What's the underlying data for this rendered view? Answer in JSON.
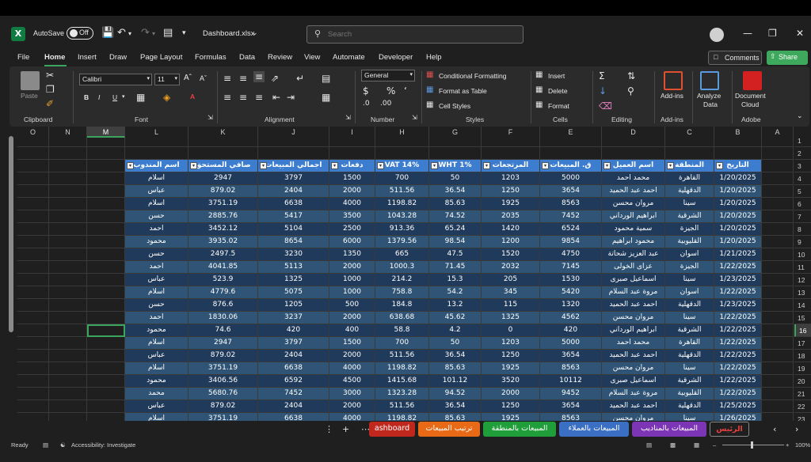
{
  "app": {
    "autosave_label": "AutoSave",
    "autosave_state": "Off",
    "filename": "Dashboard.xlsx",
    "search_placeholder": "Search"
  },
  "menu": [
    "File",
    "Home",
    "Insert",
    "Draw",
    "Page Layout",
    "Formulas",
    "Data",
    "Review",
    "View",
    "Automate",
    "Developer",
    "Help"
  ],
  "menu_active": "Home",
  "comments_label": "Comments",
  "share_label": "Share",
  "ribbon": {
    "clipboard": {
      "label": "Clipboard",
      "paste": "Paste"
    },
    "font": {
      "label": "Font",
      "name": "Calibri",
      "size": "11"
    },
    "alignment": {
      "label": "Alignment"
    },
    "number": {
      "label": "Number",
      "format": "General"
    },
    "styles": {
      "label": "Styles",
      "conditional": "Conditional Formatting",
      "table": "Format as Table",
      "cell": "Cell Styles"
    },
    "cells": {
      "label": "Cells",
      "insert": "Insert",
      "delete": "Delete",
      "format": "Format"
    },
    "editing": {
      "label": "Editing"
    },
    "addins": {
      "label": "Add-ins",
      "btn": "Add-ins"
    },
    "analyze": {
      "btn1": "Analyze",
      "btn2": "Data"
    },
    "adobe": {
      "label": "Adobe",
      "btn1": "Document",
      "btn2": "Cloud"
    }
  },
  "columns": [
    "O",
    "N",
    "M",
    "L",
    "K",
    "J",
    "I",
    "H",
    "G",
    "F",
    "E",
    "D",
    "C",
    "B",
    "A"
  ],
  "selected_column": "M",
  "row_numbers": [
    "1",
    "2",
    "3",
    "4",
    "5",
    "6",
    "7",
    "8",
    "9",
    "10",
    "11",
    "12",
    "13",
    "14",
    "15",
    "16",
    "17",
    "18",
    "19",
    "20",
    "21",
    "22",
    "23"
  ],
  "selected_row": "16",
  "table": {
    "headers": [
      "اسم المندوب",
      "صافي المستحق",
      "اجمالي المبيعات",
      "دفعات",
      "VAT 14%",
      "WHT 1%",
      "المرتجعات",
      "ق. المبيعات",
      "اسم العميل",
      "المنطقة",
      "التاريخ"
    ],
    "rows": [
      [
        "اسلام",
        "2947",
        "3797",
        "1500",
        "700",
        "50",
        "1203",
        "5000",
        "محمد احمد",
        "القاهرة",
        "1/20/2025"
      ],
      [
        "عباس",
        "879.02",
        "2404",
        "2000",
        "511.56",
        "36.54",
        "1250",
        "3654",
        "احمد عبد الحميد",
        "الدقهلية",
        "1/20/2025"
      ],
      [
        "اسلام",
        "3751.19",
        "6638",
        "4000",
        "1198.82",
        "85.63",
        "1925",
        "8563",
        "مروان محسن",
        "سينا",
        "1/20/2025"
      ],
      [
        "حسن",
        "2885.76",
        "5417",
        "3500",
        "1043.28",
        "74.52",
        "2035",
        "7452",
        "ابراهيم الورداني",
        "الشرقية",
        "1/20/2025"
      ],
      [
        "احمد",
        "3452.12",
        "5104",
        "2500",
        "913.36",
        "65.24",
        "1420",
        "6524",
        "سمية محمود",
        "الجيزة",
        "1/20/2025"
      ],
      [
        "محمود",
        "3935.02",
        "8654",
        "6000",
        "1379.56",
        "98.54",
        "1200",
        "9854",
        "محمود ابراهيم",
        "القليوبية",
        "1/20/2025"
      ],
      [
        "حسن",
        "2497.5",
        "3230",
        "1350",
        "665",
        "47.5",
        "1520",
        "4750",
        "عبد العزيز شحاتة",
        "اسوان",
        "1/21/2025"
      ],
      [
        "احمد",
        "4041.85",
        "5113",
        "2000",
        "1000.3",
        "71.45",
        "2032",
        "7145",
        "عزاى الخولى",
        "الجيزة",
        "1/22/2025"
      ],
      [
        "عباس",
        "523.9",
        "1325",
        "1000",
        "214.2",
        "15.3",
        "205",
        "1530",
        "اسماعيل صبرى",
        "سينا",
        "1/23/2025"
      ],
      [
        "اسلام",
        "4779.6",
        "5075",
        "1000",
        "758.8",
        "54.2",
        "345",
        "5420",
        "مروة عبد السلام",
        "اسوان",
        "1/22/2025"
      ],
      [
        "حسن",
        "876.6",
        "1205",
        "500",
        "184.8",
        "13.2",
        "115",
        "1320",
        "احمد عبد الحميد",
        "الدقهلية",
        "1/23/2025"
      ],
      [
        "احمد",
        "1830.06",
        "3237",
        "2000",
        "638.68",
        "45.62",
        "1325",
        "4562",
        "مروان محسن",
        "سينا",
        "1/22/2025"
      ],
      [
        "محمود",
        "74.6",
        "420",
        "400",
        "58.8",
        "4.2",
        "0",
        "420",
        "ابراهيم الورداني",
        "الشرقية",
        "1/22/2025"
      ],
      [
        "اسلام",
        "2947",
        "3797",
        "1500",
        "700",
        "50",
        "1203",
        "5000",
        "محمد احمد",
        "القاهرة",
        "1/22/2025"
      ],
      [
        "عباس",
        "879.02",
        "2404",
        "2000",
        "511.56",
        "36.54",
        "1250",
        "3654",
        "احمد عبد الحميد",
        "الدقهلية",
        "1/22/2025"
      ],
      [
        "اسلام",
        "3751.19",
        "6638",
        "4000",
        "1198.82",
        "85.63",
        "1925",
        "8563",
        "مروان محسن",
        "سينا",
        "1/22/2025"
      ],
      [
        "محمود",
        "3406.56",
        "6592",
        "4500",
        "1415.68",
        "101.12",
        "3520",
        "10112",
        "اسماعيل صبرى",
        "الشرقية",
        "1/22/2025"
      ],
      [
        "محمد",
        "5680.76",
        "7452",
        "3000",
        "1323.28",
        "94.52",
        "2000",
        "9452",
        "مروة عبد السلام",
        "القليوبية",
        "1/22/2025"
      ],
      [
        "عباس",
        "879.02",
        "2404",
        "2000",
        "511.56",
        "36.54",
        "1250",
        "3654",
        "احمد عبد الحميد",
        "الدقهلية",
        "1/25/2025"
      ],
      [
        "اسلام",
        "3751.19",
        "6638",
        "4000",
        "1198.82",
        "85.63",
        "1925",
        "8563",
        "مروان محسن",
        "سينا",
        "1/26/2025"
      ]
    ]
  },
  "sheet_tabs": [
    {
      "label": "ashboard",
      "color": "#c0281d"
    },
    {
      "label": "ترتيب المبيعات",
      "color": "#e86a16"
    },
    {
      "label": "المبيعات بالمنطقة",
      "color": "#1f9e3a"
    },
    {
      "label": "المبيعات بالعملاء",
      "color": "#3b6fc4"
    },
    {
      "label": "المبيعات بالمناديب",
      "color": "#7c35b5"
    },
    {
      "label": "الرئيس",
      "color": "#1f1f1f"
    }
  ],
  "status": {
    "ready": "Ready",
    "accessibility": "Accessibility: Investigate",
    "zoom": "100%"
  }
}
